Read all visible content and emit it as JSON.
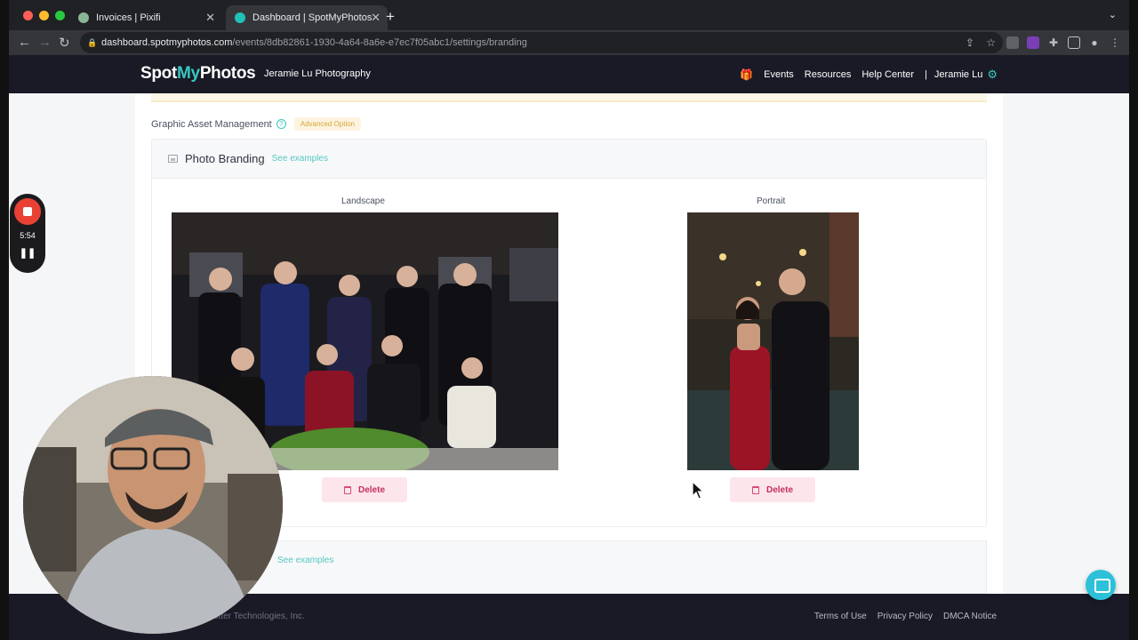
{
  "browser": {
    "tabs": [
      {
        "label": "Invoices | Pixifi",
        "active": false
      },
      {
        "label": "Dashboard | SpotMyPhotos",
        "active": true
      }
    ],
    "url_host": "dashboard.spotmyphotos.com",
    "url_path": "/events/8db82861-1930-4a64-8a6e-e7ec7f05abc1/settings/branding"
  },
  "header": {
    "logo_part1": "Spot",
    "logo_part2": "My",
    "logo_part3": "Photos",
    "studio_name": "Jeramie Lu Photography",
    "nav": {
      "events": "Events",
      "resources": "Resources",
      "help": "Help Center",
      "separator": "|",
      "user": "Jeramie Lu"
    }
  },
  "branding": {
    "section_label": "Graphic Asset Management",
    "badge": "Advanced Option",
    "card_title": "Photo Branding",
    "see_examples": "See examples",
    "landscape_label": "Landscape",
    "portrait_label": "Portrait",
    "delete_label": "Delete",
    "second_see_examples": "See examples"
  },
  "footer": {
    "copyright": "otter Technologies, Inc.",
    "links": [
      "Terms of Use",
      "Privacy Policy",
      "DMCA Notice"
    ]
  },
  "recorder": {
    "time": "5:54"
  },
  "colors": {
    "brand_teal": "#37c8c1",
    "nav_dark": "#191a26",
    "delete_text": "#c43060",
    "delete_bg": "#fde5ec",
    "badge_text": "#d6a43c"
  }
}
